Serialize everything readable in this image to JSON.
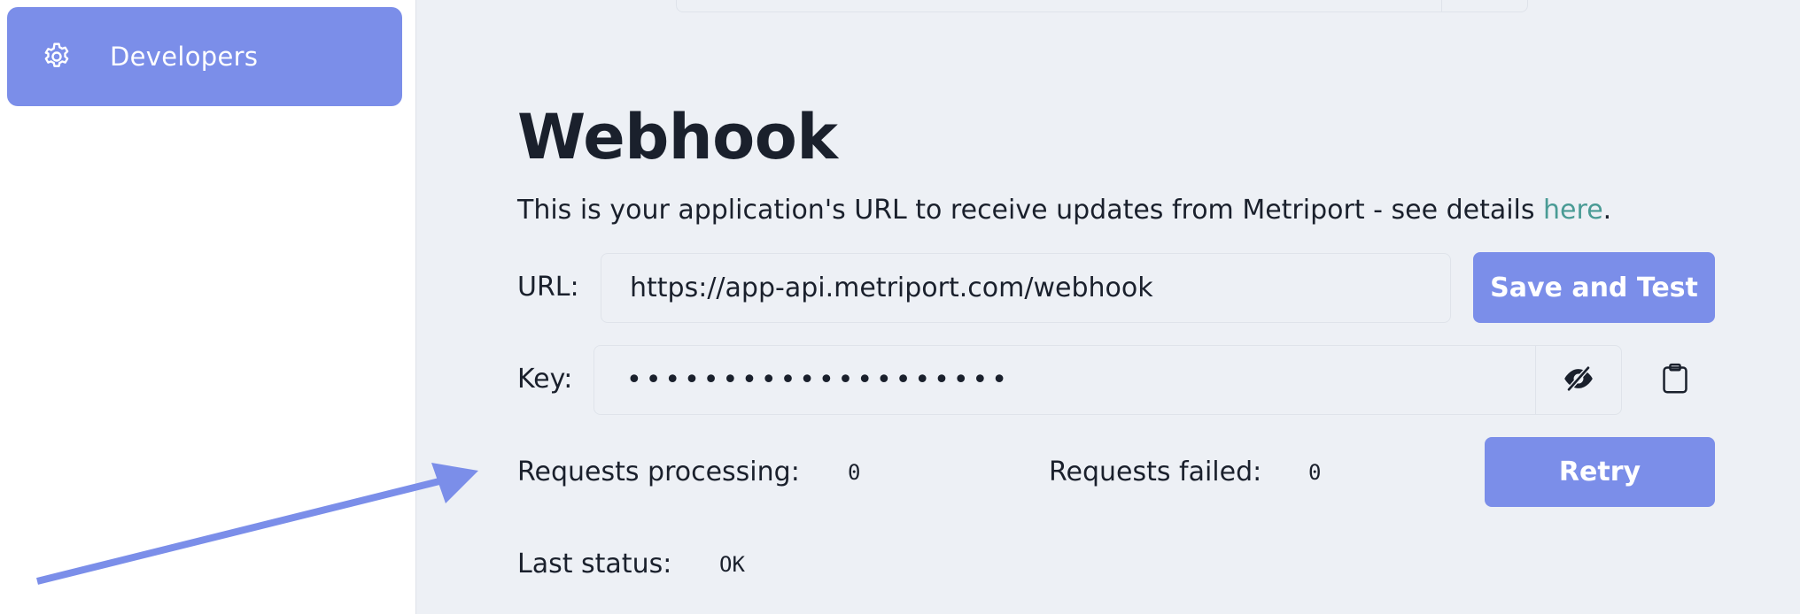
{
  "sidebar": {
    "items": [
      {
        "label": "Developers",
        "icon": "gear-icon",
        "active": true
      }
    ]
  },
  "webhook": {
    "title": "Webhook",
    "description": "This is your application's URL to receive updates from Metriport - see details ",
    "description_link": "here",
    "description_end": ".",
    "url_label": "URL:",
    "url_value": "https://app-api.metriport.com/webhook",
    "save_label": "Save and Test",
    "key_label": "Key:",
    "key_value": "••••••••••••••••••••",
    "key_toggle_icon": "eye-off-icon",
    "copy_icon": "clipboard-icon",
    "requests_processing_label": "Requests processing:",
    "requests_processing_value": "0",
    "requests_failed_label": "Requests failed:",
    "requests_failed_value": "0",
    "retry_label": "Retry",
    "last_status_label": "Last status:",
    "last_status_value": "OK"
  },
  "colors": {
    "accent": "#7b8ee9",
    "link": "#4a9b95",
    "background": "#edf0f5",
    "sidebar": "#ffffff"
  }
}
